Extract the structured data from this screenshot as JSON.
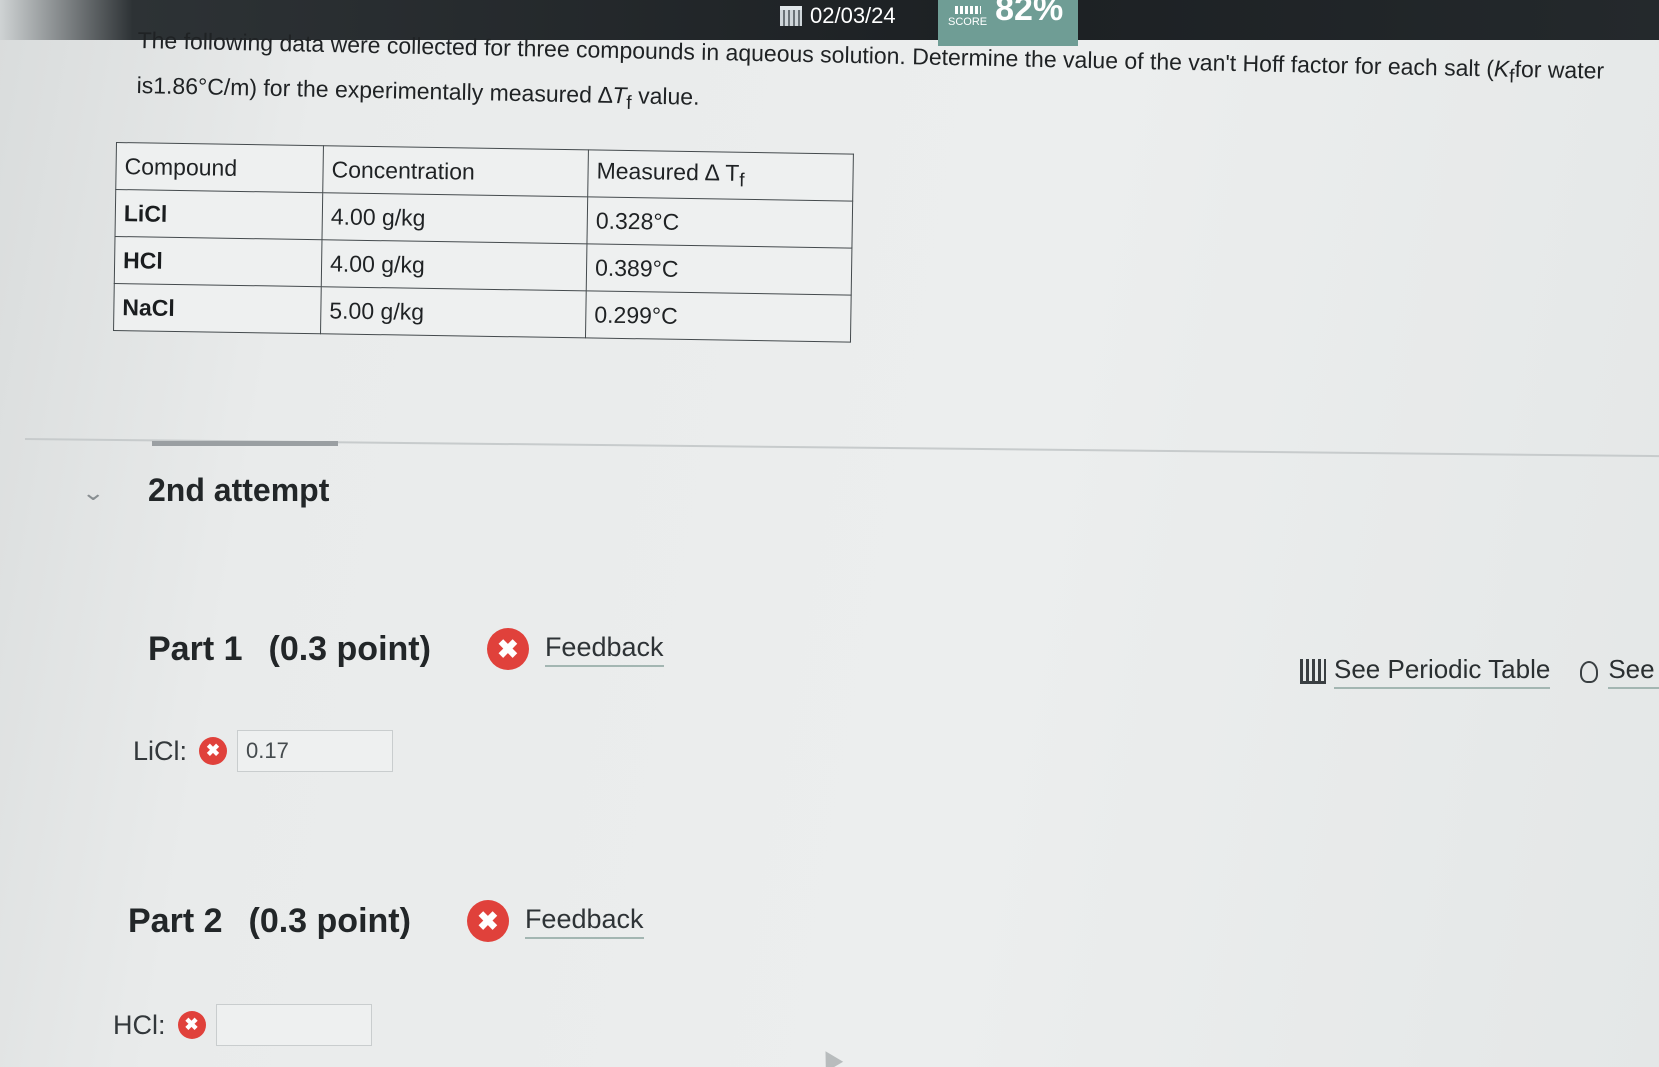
{
  "header": {
    "date": "02/03/24",
    "score_label": "SCORE",
    "score_value": "82%"
  },
  "question": {
    "text_before": "The following data were collected for three compounds in aqueous solution. Determine the value of the van't Hoff factor for each salt (",
    "kf_symbol": "K",
    "kf_sub": "f",
    "text_middle": "for water is1.86°C/m) for the experimentally measured ",
    "delta_symbol": "∆",
    "tf_symbol": "T",
    "tf_sub": "f",
    "text_after": " value."
  },
  "table": {
    "headers": [
      "Compound",
      "Concentration",
      "Measured ∆ T"
    ],
    "header_sub": "f",
    "rows": [
      {
        "compound": "LiCl",
        "concentration": "4.00 g/kg",
        "measured": "0.328°C"
      },
      {
        "compound": "HCl",
        "concentration": "4.00 g/kg",
        "measured": "0.389°C"
      },
      {
        "compound": "NaCl",
        "concentration": "5.00 g/kg",
        "measured": "0.299°C"
      }
    ]
  },
  "attempt": {
    "title": "2nd attempt"
  },
  "parts": [
    {
      "label": "Part 1",
      "points": "(0.3 point)",
      "feedback": "Feedback",
      "answer_label": "LiCl:",
      "answer_value": "0.17"
    },
    {
      "label": "Part 2",
      "points": "(0.3 point)",
      "feedback": "Feedback",
      "answer_label": "HCl:",
      "answer_value": ""
    }
  ],
  "tools": {
    "periodic_table": "See Periodic Table",
    "hint": "See H"
  },
  "icons": {
    "error": "✖",
    "chevron": "⌄"
  },
  "colors": {
    "error_red": "#e0413b",
    "score_teal": "#6f9d95"
  }
}
